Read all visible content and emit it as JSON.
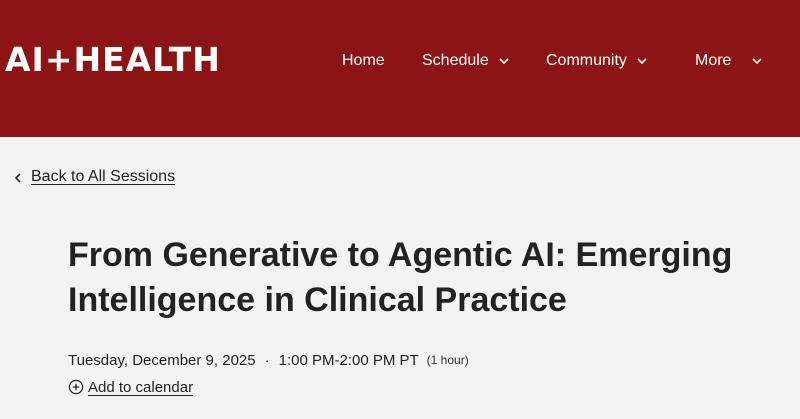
{
  "header": {
    "logo": "AI+HEALTH",
    "nav": {
      "home": "Home",
      "schedule": "Schedule",
      "community": "Community",
      "more": "More"
    },
    "background_color": "#8d1414"
  },
  "back_link": {
    "label": "Back to All Sessions"
  },
  "session": {
    "title": "From Generative to Agentic AI: Emerging Intelligence in Clinical Practice",
    "date": "Tuesday, December 9, 2025",
    "separator": "·",
    "time": "1:00 PM-2:00 PM PT",
    "duration": "(1 hour)",
    "add_to_calendar": "Add to calendar"
  },
  "icons": [
    "chevron-down-icon",
    "chevron-left-icon",
    "plus-circle-icon"
  ]
}
